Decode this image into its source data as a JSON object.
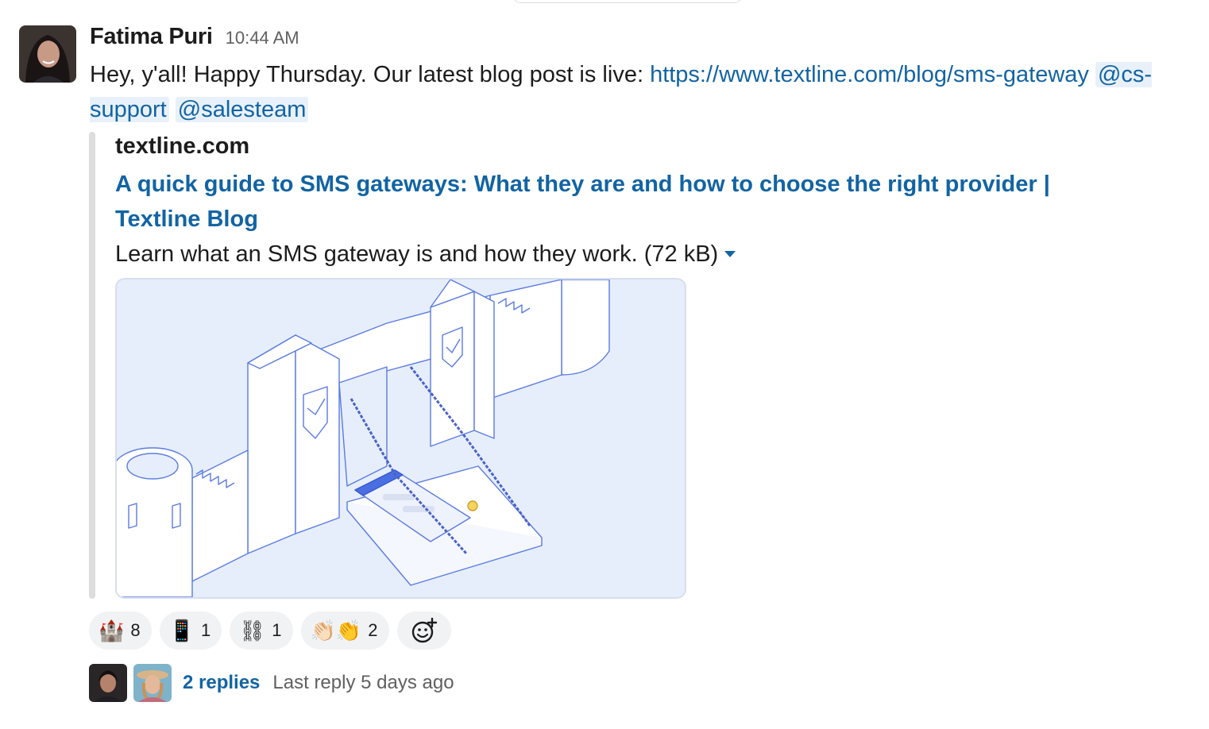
{
  "message": {
    "author": "Fatima Puri",
    "timestamp": "10:44 AM",
    "text_prefix": "Hey, y'all! Happy Thursday. Our latest blog post is live: ",
    "link": "https://www.textline.com/blog/sms-gateway",
    "mention_1": "@cs-support",
    "mention_2": "@salesteam"
  },
  "attachment": {
    "site": "textline.com",
    "title": "A quick guide to SMS gateways: What they are and how to choose the right provider | Textline Blog",
    "description": "Learn what an SMS gateway is and how they work. (72 kB)"
  },
  "reactions": [
    {
      "icon": "castle-emoji",
      "emoji": "🏰",
      "count": "8"
    },
    {
      "icon": "mobile-phone-emoji",
      "emoji": "📱",
      "count": "1"
    },
    {
      "icon": "chains-emoji",
      "emoji": "⛓",
      "count": "1"
    },
    {
      "icon": "clapping-hands-emoji",
      "emoji": "👏🏻👏",
      "count": "2"
    }
  ],
  "thread": {
    "reply_count": "2 replies",
    "last_reply": "Last reply 5 days ago"
  },
  "colors": {
    "link": "#1264a3",
    "mention_bg": "#e8f1fa",
    "reaction_bg": "#f1f2f4",
    "illustration_bg": "#e6eefc",
    "illustration_line": "#5b7be0"
  }
}
